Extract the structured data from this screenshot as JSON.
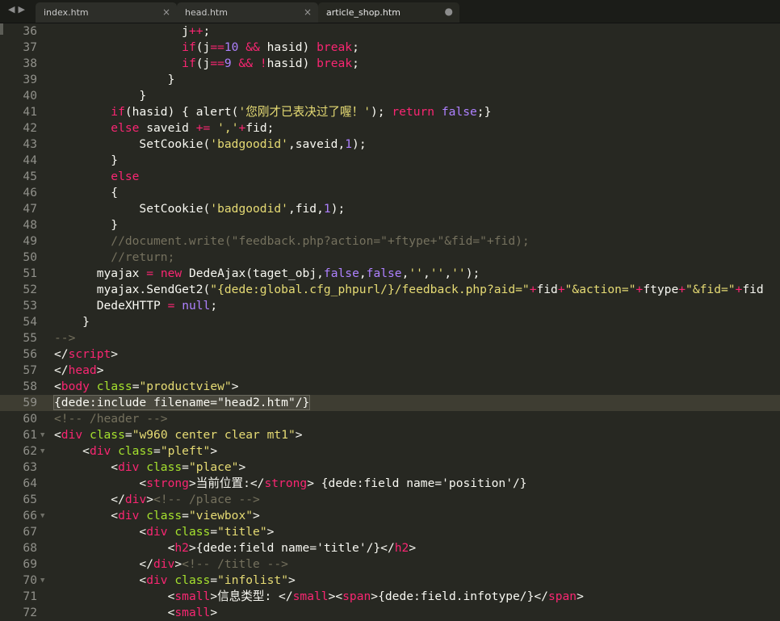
{
  "tabs": [
    {
      "label": "index.htm",
      "active": false,
      "close": "×"
    },
    {
      "label": "head.htm",
      "active": false,
      "close": "×"
    },
    {
      "label": "article_shop.htm",
      "active": true,
      "close": "●"
    }
  ],
  "nav": {
    "back": "◀",
    "forward": "▶"
  },
  "current_line": "59",
  "lines": [
    {
      "n": "36",
      "fold": "",
      "segs": [
        [
          "def",
          "                  j"
        ],
        [
          "kw",
          "++"
        ],
        [
          "def",
          ";"
        ]
      ]
    },
    {
      "n": "37",
      "fold": "",
      "segs": [
        [
          "def",
          "                  "
        ],
        [
          "kw",
          "if"
        ],
        [
          "def",
          "(j"
        ],
        [
          "kw",
          "=="
        ],
        [
          "num",
          "10"
        ],
        [
          "def",
          " "
        ],
        [
          "kw",
          "&&"
        ],
        [
          "def",
          " hasid) "
        ],
        [
          "kw",
          "break"
        ],
        [
          "def",
          ";"
        ]
      ]
    },
    {
      "n": "38",
      "fold": "",
      "segs": [
        [
          "def",
          "                  "
        ],
        [
          "kw",
          "if"
        ],
        [
          "def",
          "(j"
        ],
        [
          "kw",
          "=="
        ],
        [
          "num",
          "9"
        ],
        [
          "def",
          " "
        ],
        [
          "kw",
          "&&"
        ],
        [
          "def",
          " "
        ],
        [
          "kw",
          "!"
        ],
        [
          "def",
          "hasid) "
        ],
        [
          "kw",
          "break"
        ],
        [
          "def",
          ";"
        ]
      ]
    },
    {
      "n": "39",
      "fold": "",
      "segs": [
        [
          "def",
          "                }"
        ]
      ]
    },
    {
      "n": "40",
      "fold": "",
      "segs": [
        [
          "def",
          "            }"
        ]
      ]
    },
    {
      "n": "41",
      "fold": "",
      "segs": [
        [
          "def",
          "        "
        ],
        [
          "kw",
          "if"
        ],
        [
          "def",
          "(hasid) { alert("
        ],
        [
          "str",
          "'您刚才已表决过了喔！'"
        ],
        [
          "def",
          "); "
        ],
        [
          "kw",
          "return"
        ],
        [
          "def",
          " "
        ],
        [
          "const",
          "false"
        ],
        [
          "def",
          ";}"
        ]
      ]
    },
    {
      "n": "42",
      "fold": "",
      "segs": [
        [
          "def",
          "        "
        ],
        [
          "kw",
          "else"
        ],
        [
          "def",
          " saveid "
        ],
        [
          "kw",
          "+="
        ],
        [
          "def",
          " "
        ],
        [
          "str",
          "','"
        ],
        [
          "kw",
          "+"
        ],
        [
          "def",
          "fid;"
        ]
      ]
    },
    {
      "n": "43",
      "fold": "",
      "segs": [
        [
          "def",
          "            SetCookie("
        ],
        [
          "str",
          "'badgoodid'"
        ],
        [
          "def",
          ",saveid,"
        ],
        [
          "num",
          "1"
        ],
        [
          "def",
          ");"
        ]
      ]
    },
    {
      "n": "44",
      "fold": "",
      "segs": [
        [
          "def",
          "        }"
        ]
      ]
    },
    {
      "n": "45",
      "fold": "",
      "segs": [
        [
          "def",
          "        "
        ],
        [
          "kw",
          "else"
        ]
      ]
    },
    {
      "n": "46",
      "fold": "",
      "segs": [
        [
          "def",
          "        {"
        ]
      ]
    },
    {
      "n": "47",
      "fold": "",
      "segs": [
        [
          "def",
          "            SetCookie("
        ],
        [
          "str",
          "'badgoodid'"
        ],
        [
          "def",
          ",fid,"
        ],
        [
          "num",
          "1"
        ],
        [
          "def",
          ");"
        ]
      ]
    },
    {
      "n": "48",
      "fold": "",
      "segs": [
        [
          "def",
          "        }"
        ]
      ]
    },
    {
      "n": "49",
      "fold": "",
      "segs": [
        [
          "com",
          "        //document.write(\"feedback.php?action=\"+ftype+\"&fid=\"+fid);"
        ]
      ]
    },
    {
      "n": "50",
      "fold": "",
      "segs": [
        [
          "com",
          "        //return;"
        ]
      ]
    },
    {
      "n": "51",
      "fold": "",
      "segs": [
        [
          "def",
          "      myajax "
        ],
        [
          "kw",
          "="
        ],
        [
          "def",
          " "
        ],
        [
          "kw",
          "new"
        ],
        [
          "def",
          " DedeAjax(taget_obj,"
        ],
        [
          "const",
          "false"
        ],
        [
          "def",
          ","
        ],
        [
          "const",
          "false"
        ],
        [
          "def",
          ","
        ],
        [
          "str",
          "''"
        ],
        [
          "def",
          ","
        ],
        [
          "str",
          "''"
        ],
        [
          "def",
          ","
        ],
        [
          "str",
          "''"
        ],
        [
          "def",
          ");"
        ]
      ]
    },
    {
      "n": "52",
      "fold": "",
      "segs": [
        [
          "def",
          "      myajax.SendGet2("
        ],
        [
          "str",
          "\"{dede:global.cfg_phpurl/}/feedback.php?aid=\""
        ],
        [
          "kw",
          "+"
        ],
        [
          "def",
          "fid"
        ],
        [
          "kw",
          "+"
        ],
        [
          "str",
          "\"&action=\""
        ],
        [
          "kw",
          "+"
        ],
        [
          "def",
          "ftype"
        ],
        [
          "kw",
          "+"
        ],
        [
          "str",
          "\"&fid=\""
        ],
        [
          "kw",
          "+"
        ],
        [
          "def",
          "fid"
        ]
      ]
    },
    {
      "n": "53",
      "fold": "",
      "segs": [
        [
          "def",
          "      DedeXHTTP "
        ],
        [
          "kw",
          "="
        ],
        [
          "def",
          " "
        ],
        [
          "const",
          "null"
        ],
        [
          "def",
          ";"
        ]
      ]
    },
    {
      "n": "54",
      "fold": "",
      "segs": [
        [
          "def",
          "    }"
        ]
      ]
    },
    {
      "n": "55",
      "fold": "",
      "segs": [
        [
          "com",
          "-->"
        ]
      ]
    },
    {
      "n": "56",
      "fold": "",
      "segs": [
        [
          "def",
          "</"
        ],
        [
          "tag",
          "script"
        ],
        [
          "def",
          ">"
        ]
      ]
    },
    {
      "n": "57",
      "fold": "",
      "segs": [
        [
          "def",
          "</"
        ],
        [
          "tag",
          "head"
        ],
        [
          "def",
          ">"
        ]
      ]
    },
    {
      "n": "58",
      "fold": "",
      "segs": [
        [
          "def",
          "<"
        ],
        [
          "tag",
          "body"
        ],
        [
          "def",
          " "
        ],
        [
          "attr",
          "class"
        ],
        [
          "def",
          "="
        ],
        [
          "str",
          "\"productview\""
        ],
        [
          "def",
          ">"
        ]
      ]
    },
    {
      "n": "59",
      "fold": "",
      "segs": [
        [
          "sel",
          "{dede:include filename=\"head2.htm\"/}"
        ]
      ]
    },
    {
      "n": "60",
      "fold": "",
      "segs": [
        [
          "com",
          "<!-- /header -->"
        ]
      ]
    },
    {
      "n": "61",
      "fold": "▼",
      "segs": [
        [
          "def",
          "<"
        ],
        [
          "tag",
          "div"
        ],
        [
          "def",
          " "
        ],
        [
          "attr",
          "class"
        ],
        [
          "def",
          "="
        ],
        [
          "str",
          "\"w960 center clear mt1\""
        ],
        [
          "def",
          ">"
        ]
      ]
    },
    {
      "n": "62",
      "fold": "▼",
      "segs": [
        [
          "def",
          "    <"
        ],
        [
          "tag",
          "div"
        ],
        [
          "def",
          " "
        ],
        [
          "attr",
          "class"
        ],
        [
          "def",
          "="
        ],
        [
          "str",
          "\"pleft\""
        ],
        [
          "def",
          ">"
        ]
      ]
    },
    {
      "n": "63",
      "fold": "",
      "segs": [
        [
          "def",
          "        <"
        ],
        [
          "tag",
          "div"
        ],
        [
          "def",
          " "
        ],
        [
          "attr",
          "class"
        ],
        [
          "def",
          "="
        ],
        [
          "str",
          "\"place\""
        ],
        [
          "def",
          ">"
        ]
      ]
    },
    {
      "n": "64",
      "fold": "",
      "segs": [
        [
          "def",
          "            <"
        ],
        [
          "tag",
          "strong"
        ],
        [
          "def",
          ">当前位置:</"
        ],
        [
          "tag",
          "strong"
        ],
        [
          "def",
          "> {dede:field name='position'/}"
        ]
      ]
    },
    {
      "n": "65",
      "fold": "",
      "segs": [
        [
          "def",
          "        </"
        ],
        [
          "tag",
          "div"
        ],
        [
          "def",
          ">"
        ],
        [
          "com",
          "<!-- /place -->"
        ]
      ]
    },
    {
      "n": "66",
      "fold": "▼",
      "segs": [
        [
          "def",
          "        <"
        ],
        [
          "tag",
          "div"
        ],
        [
          "def",
          " "
        ],
        [
          "attr",
          "class"
        ],
        [
          "def",
          "="
        ],
        [
          "str",
          "\"viewbox\""
        ],
        [
          "def",
          ">"
        ]
      ]
    },
    {
      "n": "67",
      "fold": "",
      "segs": [
        [
          "def",
          "            <"
        ],
        [
          "tag",
          "div"
        ],
        [
          "def",
          " "
        ],
        [
          "attr",
          "class"
        ],
        [
          "def",
          "="
        ],
        [
          "str",
          "\"title\""
        ],
        [
          "def",
          ">"
        ]
      ]
    },
    {
      "n": "68",
      "fold": "",
      "segs": [
        [
          "def",
          "                <"
        ],
        [
          "tag",
          "h2"
        ],
        [
          "def",
          ">{dede:field name='title'/}</"
        ],
        [
          "tag",
          "h2"
        ],
        [
          "def",
          ">"
        ]
      ]
    },
    {
      "n": "69",
      "fold": "",
      "segs": [
        [
          "def",
          "            </"
        ],
        [
          "tag",
          "div"
        ],
        [
          "def",
          ">"
        ],
        [
          "com",
          "<!-- /title -->"
        ]
      ]
    },
    {
      "n": "70",
      "fold": "▼",
      "segs": [
        [
          "def",
          "            <"
        ],
        [
          "tag",
          "div"
        ],
        [
          "def",
          " "
        ],
        [
          "attr",
          "class"
        ],
        [
          "def",
          "="
        ],
        [
          "str",
          "\"infolist\""
        ],
        [
          "def",
          ">"
        ]
      ]
    },
    {
      "n": "71",
      "fold": "",
      "segs": [
        [
          "def",
          "                <"
        ],
        [
          "tag",
          "small"
        ],
        [
          "def",
          ">信息类型: </"
        ],
        [
          "tag",
          "small"
        ],
        [
          "def",
          "><"
        ],
        [
          "tag",
          "span"
        ],
        [
          "def",
          ">{dede:field.infotype/}</"
        ],
        [
          "tag",
          "span"
        ],
        [
          "def",
          ">"
        ]
      ]
    },
    {
      "n": "72",
      "fold": "",
      "segs": [
        [
          "def",
          "                <"
        ],
        [
          "tag",
          "small"
        ],
        [
          "def",
          ">"
        ]
      ]
    }
  ]
}
